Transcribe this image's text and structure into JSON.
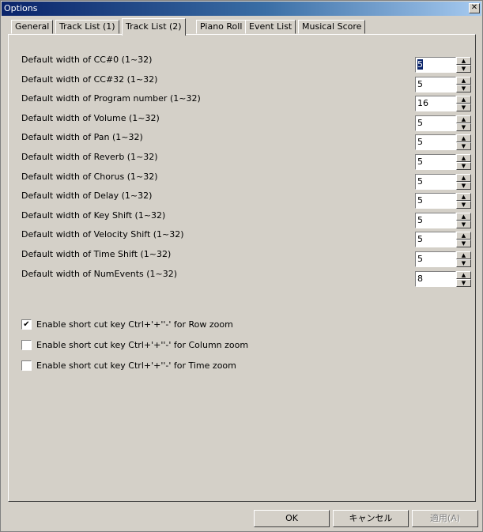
{
  "window": {
    "title": "Options",
    "close_glyph": "✕"
  },
  "tabs": [
    "General",
    "Track List (1)",
    "Track List (2)",
    "Piano Roll",
    "Event List",
    "Musical Score"
  ],
  "active_tab_index": 2,
  "fields": [
    {
      "label": "Default width of CC#0 (1~32)",
      "value": "5",
      "selected": true
    },
    {
      "label": "Default width of CC#32 (1~32)",
      "value": "5"
    },
    {
      "label": "Default width of Program number (1~32)",
      "value": "16"
    },
    {
      "label": "Default width of Volume (1~32)",
      "value": "5"
    },
    {
      "label": "Default width of Pan (1~32)",
      "value": "5"
    },
    {
      "label": "Default width of Reverb (1~32)",
      "value": "5"
    },
    {
      "label": "Default width of Chorus (1~32)",
      "value": "5"
    },
    {
      "label": "Default width of Delay (1~32)",
      "value": "5"
    },
    {
      "label": "Default width of Key Shift (1~32)",
      "value": "5"
    },
    {
      "label": "Default width of Velocity Shift (1~32)",
      "value": "5"
    },
    {
      "label": "Default width of Time Shift (1~32)",
      "value": "5"
    },
    {
      "label": "Default width of NumEvents (1~32)",
      "value": "8"
    }
  ],
  "checkboxes": [
    {
      "label": "Enable short cut key Ctrl+'+''-' for Row zoom",
      "checked": true
    },
    {
      "label": "Enable short cut key Ctrl+'+''-' for Column zoom",
      "checked": false
    },
    {
      "label": "Enable short cut key Ctrl+'+''-' for Time zoom",
      "checked": false
    }
  ],
  "buttons": {
    "ok": "OK",
    "cancel": "キャンセル",
    "apply": "適用(A)"
  },
  "colors": {
    "face": "#d4d0c8",
    "title_start": "#0a246a",
    "title_end": "#a6caf0"
  }
}
